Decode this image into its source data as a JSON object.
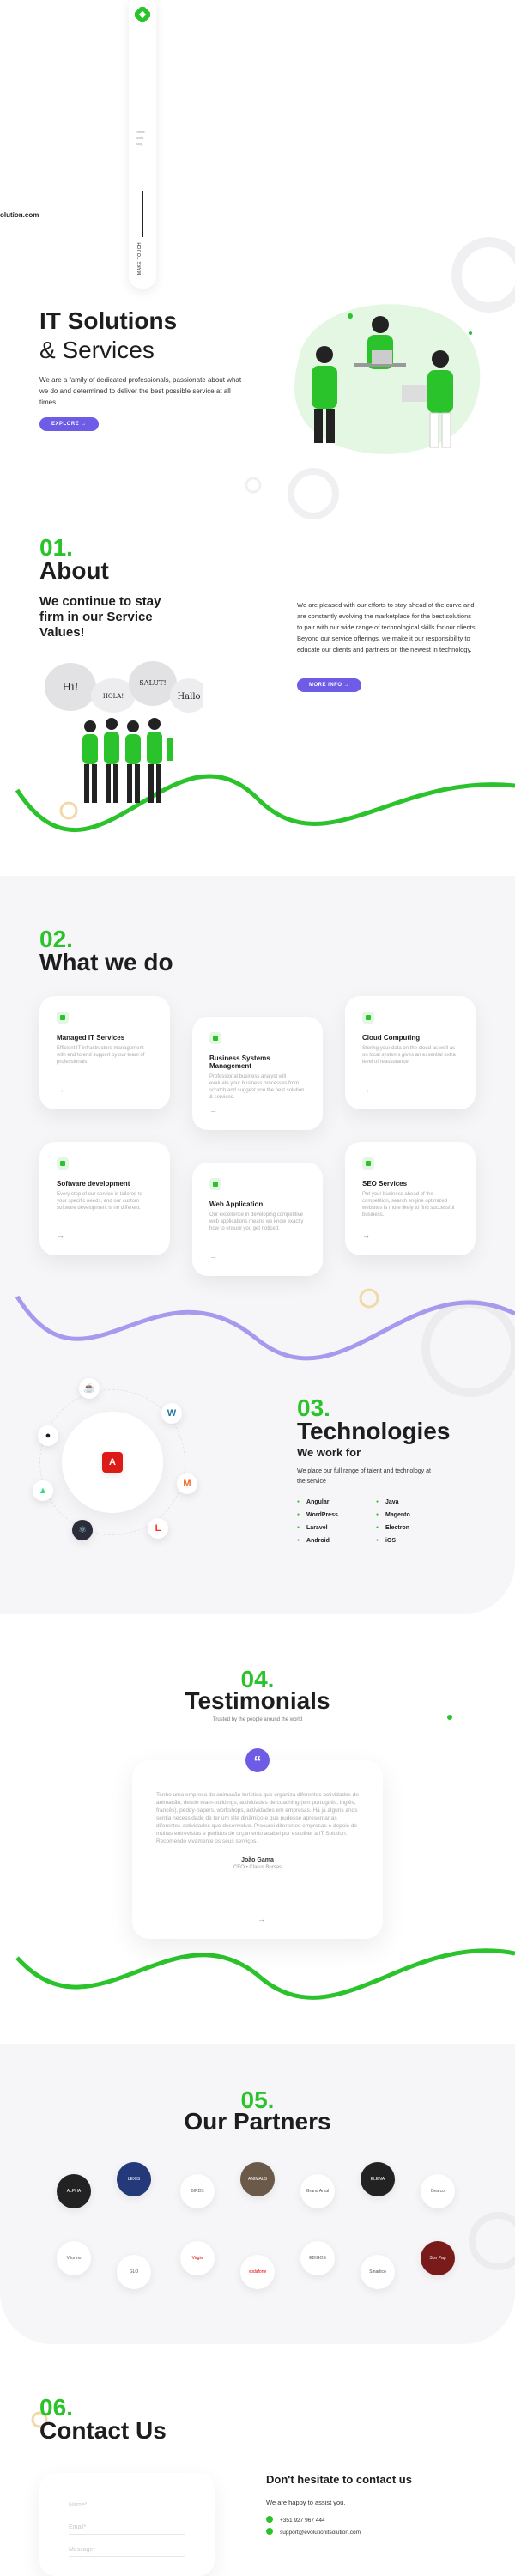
{
  "site": {
    "url": "olution.com"
  },
  "sidebar": {
    "menu": [
      "Home",
      "Work",
      "Blog"
    ],
    "vertical_label": "MAKE TOUCH"
  },
  "hero": {
    "title": "IT Solutions",
    "subtitle": "& Services",
    "text": "We are a family of dedicated professionals, passionate about what we do and determined to deliver the best possible service at all times.",
    "button": "EXPLORE  →"
  },
  "about": {
    "number": "01.",
    "title": "About",
    "tagline": "We continue to stay firm in our Service Values!",
    "text": "We are pleased with our efforts to stay ahead of the curve and are constantly evolving the marketplace for the best solutions to pair with our wide range of technological skills for our clients. Beyond our service offerings, we make it our responsibility to educate our clients and partners on the newest in technology.",
    "button": "MORE INFO  →",
    "bubbles": [
      "Hi!",
      "HOLA!",
      "SALUT!",
      "Hallo"
    ]
  },
  "whatwedo": {
    "number": "02.",
    "title": "What we do",
    "cards": [
      {
        "title": "Managed IT Services",
        "desc": "Efficient IT infrastructure management with end to end support by our team of professionals."
      },
      {
        "title": "Business Systems Management",
        "desc": "Professional business analyst will evaluate your business processes from scratch and suggest you the best solution & services."
      },
      {
        "title": "Cloud Computing",
        "desc": "Storing your data on the cloud as well as on local systems gives an essential extra level of reassurance."
      },
      {
        "title": "Software development",
        "desc": "Every step of our service is tailored to your specific needs, and our custom software development is no different."
      },
      {
        "title": "Web Application",
        "desc": "Our excellence in developing competitive web applications means we know exactly how to ensure you get noticed."
      },
      {
        "title": "SEO Services",
        "desc": "Put your business ahead of the competition, search engine optimized websites is more likely to find successful business."
      }
    ],
    "arrow": "→"
  },
  "technologies": {
    "number": "03.",
    "title": "Technologies",
    "subtitle": "We work for",
    "text": "We place our full range of talent and technology at the service",
    "col1": [
      "Angular",
      "WordPress",
      "Laravel",
      "Android"
    ],
    "col2": [
      "Java",
      "Magento",
      "Electron",
      "iOS"
    ]
  },
  "testimonials": {
    "number": "04.",
    "title": "Testimonials",
    "subtitle": "Trusted by the people around the world",
    "quote_mark": "“",
    "text": "Tenho uma empresa de animação turística que organiza diferentes actividades de animação, desde team-buildings, actividades de coaching (em português, inglês, francês), peddy-papers, workshops, actividades em empresas. Há já alguns anos sentia necessidade de ter um site dinâmico e que pudesse apresentar as diferentes actividades que desenvolvo. Procurei diferentes empresas e depois de muitas entrevistas e pedidos de orçamento acabei por escolher a IT Solution. Recomendo vivamente os seus serviços.",
    "name": "João Gama",
    "role": "CEO • Clarus Bursas",
    "arrow": "→"
  },
  "partners": {
    "number": "05.",
    "title": "Our Partners",
    "row1": [
      "ALPHA",
      "LEXIS",
      "BIRDS",
      "ANIMALS",
      "Grand Amal",
      "ELENA",
      "Bearco"
    ],
    "row2": [
      "Vitorino",
      "GLO",
      "Virgin",
      "vodafone",
      "EDIGOS",
      "Sinartico",
      "Son Pag"
    ]
  },
  "contact": {
    "number": "06.",
    "title": "Contact Us",
    "heading": "Don't hesitate to contact us",
    "sub": "We are happy to assist you.",
    "phone": "+351 927 967 444",
    "email": "support@evolutionitsolution.com",
    "fields": [
      "Name*",
      "Email*",
      "Message*"
    ]
  },
  "colors": {
    "accent_green": "#2bc32b",
    "accent_purple": "#6f5ce6"
  }
}
